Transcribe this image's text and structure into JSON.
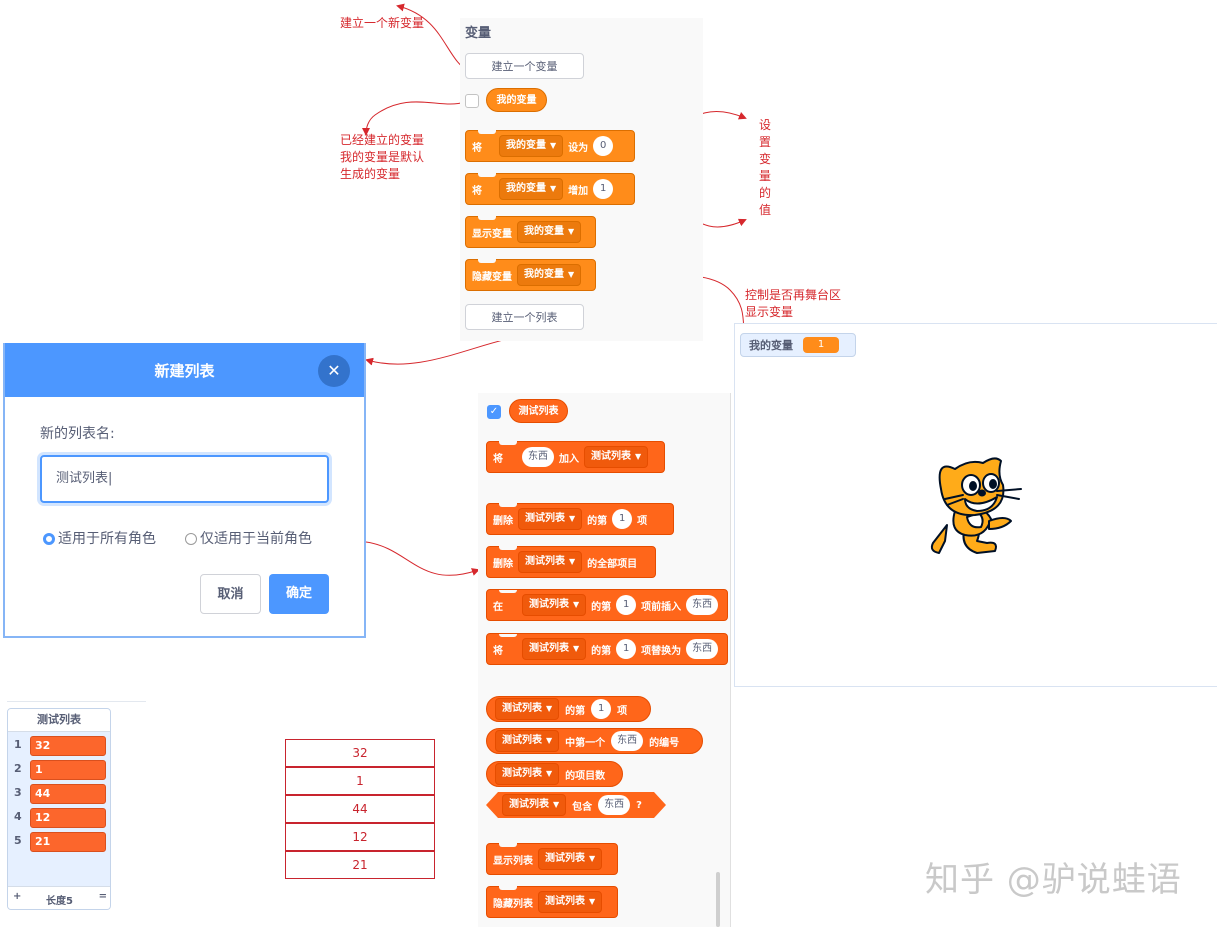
{
  "annotations": {
    "new_var": "建立一个新变量",
    "existing_var": [
      "已经建立的变量",
      "我的变量是默认",
      "生成的变量"
    ],
    "set_value_chars": [
      "设",
      "置",
      "变",
      "量",
      "的",
      "值"
    ],
    "show_control": [
      "控制是否再舞台区",
      "显示变量"
    ]
  },
  "palette": {
    "category": "变量",
    "make_variable": "建立一个变量",
    "variable_name": "我的变量",
    "set_block": {
      "prefix": "将",
      "var": "我的变量",
      "verb": "设为",
      "value": "0"
    },
    "change_block": {
      "prefix": "将",
      "var": "我的变量",
      "verb": "增加",
      "value": "1"
    },
    "show_var": {
      "label": "显示变量",
      "var": "我的变量"
    },
    "hide_var": {
      "label": "隐藏变量",
      "var": "我的变量"
    },
    "make_list": "建立一个列表"
  },
  "list_blocks": {
    "list_name": "测试列表",
    "add": {
      "prefix": "将",
      "item": "东西",
      "verb": "加入",
      "list": "测试列表"
    },
    "delete": {
      "prefix": "删除",
      "list": "测试列表",
      "mid": "的第",
      "index": "1",
      "suffix": "项"
    },
    "delete_all": {
      "prefix": "删除",
      "list": "测试列表",
      "suffix": "的全部项目"
    },
    "insert": {
      "prefix": "在",
      "list": "测试列表",
      "mid": "的第",
      "index": "1",
      "suffix": "项前插入",
      "item": "东西"
    },
    "replace": {
      "prefix": "将",
      "list": "测试列表",
      "mid": "的第",
      "index": "1",
      "suffix": "项替换为",
      "item": "东西"
    },
    "item_of": {
      "list": "测试列表",
      "mid": "的第",
      "index": "1",
      "suffix": "项"
    },
    "index_of": {
      "list": "测试列表",
      "mid": "中第一个",
      "item": "东西",
      "suffix": "的编号"
    },
    "length": {
      "list": "测试列表",
      "suffix": "的项目数"
    },
    "contains": {
      "list": "测试列表",
      "mid": "包含",
      "item": "东西",
      "suffix": "?"
    },
    "show_list": {
      "label": "显示列表",
      "list": "测试列表"
    },
    "hide_list": {
      "label": "隐藏列表",
      "list": "测试列表"
    }
  },
  "stage": {
    "monitor_label": "我的变量",
    "monitor_value": "1"
  },
  "dialog": {
    "title": "新建列表",
    "label": "新的列表名:",
    "input_value": "测试列表",
    "option_all": "适用于所有角色",
    "option_current": "仅适用于当前角色",
    "cancel": "取消",
    "ok": "确定"
  },
  "list_monitor": {
    "title": "测试列表",
    "rows": [
      {
        "index": "1",
        "value": "32"
      },
      {
        "index": "2",
        "value": "1"
      },
      {
        "index": "3",
        "value": "44"
      },
      {
        "index": "4",
        "value": "12"
      },
      {
        "index": "5",
        "value": "21"
      }
    ],
    "add": "+",
    "length_label": "长度5",
    "resize": "="
  },
  "data_table": [
    "32",
    "1",
    "44",
    "12",
    "21"
  ],
  "watermark": "知乎 @驴说蛙语",
  "colors": {
    "annotation": "#d6282d",
    "variable_block": "#ff8c1a",
    "list_block": "#ff661a",
    "dialog_header": "#4c97ff"
  }
}
